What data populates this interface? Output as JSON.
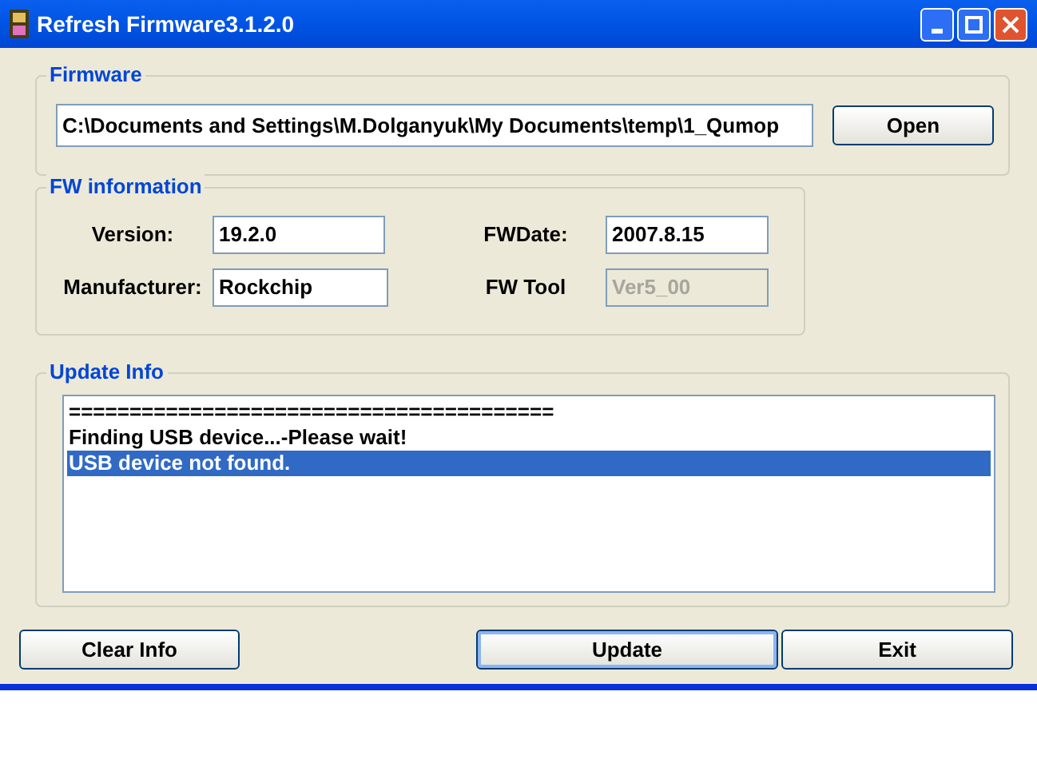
{
  "window": {
    "title": "Refresh Firmware3.1.2.0"
  },
  "firmware": {
    "legend": "Firmware",
    "path": "C:\\Documents and Settings\\M.Dolganyuk\\My Documents\\temp\\1_Qumop",
    "open_button": "Open"
  },
  "fw_information": {
    "legend": "FW information",
    "fields": [
      {
        "label": "Version:",
        "value": "19.2.0",
        "disabled": false
      },
      {
        "label": "FWDate:",
        "value": "2007.8.15",
        "disabled": false
      },
      {
        "label": "Manufacturer:",
        "value": "Rockchip",
        "disabled": false
      },
      {
        "label": "FW Tool",
        "value": "Ver5_00",
        "disabled": true
      }
    ]
  },
  "update_info": {
    "legend": "Update Info",
    "lines": [
      {
        "text": "========================================",
        "selected": false
      },
      {
        "text": "Finding USB device...-Please wait!",
        "selected": false
      },
      {
        "text": "USB device not found.",
        "selected": true
      }
    ]
  },
  "buttons": [
    {
      "label": "Clear Info",
      "default": false
    },
    {
      "label": "Update",
      "default": true
    },
    {
      "label": "Exit",
      "default": false
    }
  ]
}
